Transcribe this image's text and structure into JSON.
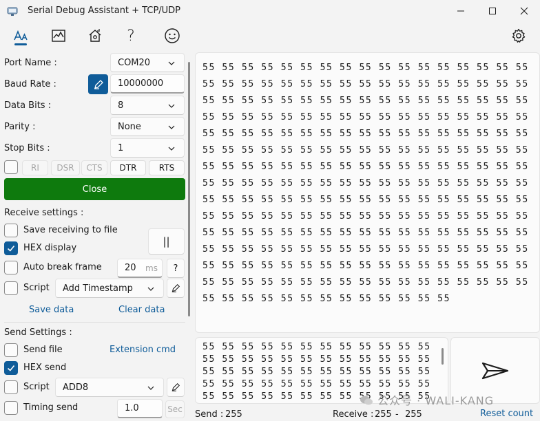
{
  "window": {
    "title": "Serial Debug Assistant + TCP/UDP",
    "minimize_icon": "minimize-icon",
    "maximize_icon": "maximize-icon",
    "close_icon": "close-icon"
  },
  "toolbar": {
    "tools": [
      "font-style-icon",
      "chart-icon",
      "network-icon",
      "help-icon",
      "smiley-icon"
    ],
    "settings_icon": "gear-icon",
    "help_glyph": "?"
  },
  "port": {
    "port_name_label": "Port Name :",
    "port_name_value": "COM20",
    "baud_rate_label": "Baud Rate :",
    "baud_rate_value": "10000000",
    "data_bits_label": "Data Bits :",
    "data_bits_value": "8",
    "parity_label": "Parity :",
    "parity_value": "None",
    "stop_bits_label": "Stop Bits :",
    "stop_bits_value": "1",
    "pins": {
      "ri": "RI",
      "dsr": "DSR",
      "cts": "CTS",
      "dtr": "DTR",
      "rts": "RTS"
    },
    "close_label": "Close",
    "close_color": "#0e7a0d"
  },
  "receive": {
    "section_label": "Receive settings :",
    "save_to_file_label": "Save receiving to file",
    "hex_display_label": "HEX display",
    "auto_break_label": "Auto break frame",
    "auto_break_value": "20",
    "auto_break_unit": "ms",
    "auto_break_help": "?",
    "script_label": "Script",
    "script_value": "Add Timestamp",
    "pause_glyph": "||",
    "save_data_label": "Save data",
    "clear_data_label": "Clear data",
    "text": "55 55 55 55 55 55 55 55 55 55 55 55 55 55 55 55 55 55 55 55 55 55 55 55 55 55 55 55 55 55 55 55 55 55 55 55 55 55 55 55 55 55 55 55 55 55 55 55 55 55 55 55 55 55 55 55 55 55 55 55 55 55 55 55 55 55 55 55 55 55 55 55 55 55 55 55 55 55 55 55 55 55 55 55 55 55 55 55 55 55 55 55 55 55 55 55 55 55 55 55 55 55 55 55 55 55 55 55 55 55 55 55 55 55 55 55 55 55 55 55 55 55 55 55 55 55 55 55 55 55 55 55 55 55 55 55 55 55 55 55 55 55 55 55 55 55 55 55 55 55 55 55 55 55 55 55 55 55 55 55 55 55 55 55 55 55 55 55 55 55 55 55 55 55 55 55 55 55 55 55 55 55 55 55 55 55 55 55 55 55 55 55 55 55 55 55 55 55 55 55 55 55 55 55 55 55 55 55 55 55 55 55 55 55 55 55 55 55 55 55 55 55 55 55 55 55 55 55 55 55 55 55 55 55 55 55 55 55 55 55 55 55 55 55 55 55 55 55 55 55 55"
  },
  "send": {
    "section_label": "Send Settings :",
    "send_file_label": "Send file",
    "extension_cmd_label": "Extension cmd",
    "hex_send_label": "HEX send",
    "script_label": "Script",
    "script_value": "ADD8",
    "timing_label": "Timing send",
    "timing_value": "1.0",
    "timing_unit": "Sec",
    "text": "55 55 55 55 55 55 55 55 55 55 55 55 55 55 55 55 55 55 55 55 55 55 55 55 55 55 55 55 55 55 55 55 55 55 55 55 55 55 55 55 55 55 55 55 55 55 55 55 55 55 55 55 55 55 55 55 55 55 55 55 55 55 55 55 55 55 55 55 55 55 55 55 55 55 55 55 55 55 55 55 55 55 55 55"
  },
  "status": {
    "send_label": "Send :",
    "send_value": "255",
    "receive_label": "Receive :",
    "receive_value": "255",
    "receive_sep": "-",
    "receive_value2": "255",
    "reset_label": "Reset count"
  },
  "watermark": "公众号 · WALI-KANG"
}
